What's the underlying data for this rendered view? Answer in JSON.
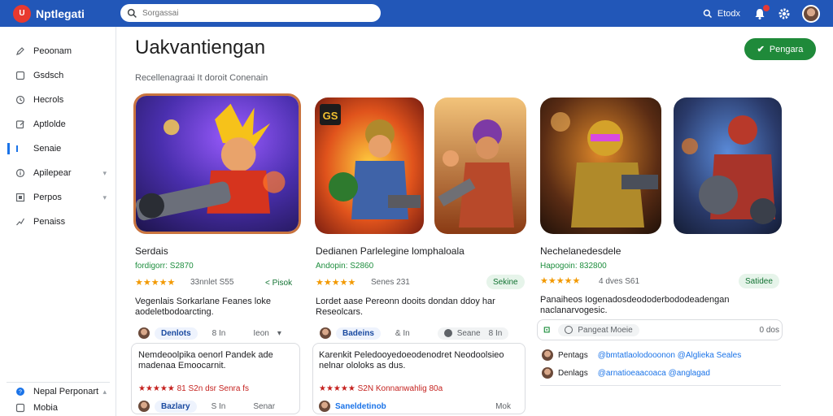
{
  "app": {
    "logo_mark": "U",
    "name": "Nptlegati"
  },
  "search": {
    "placeholder": "Sorgassai"
  },
  "topbar": {
    "search_label": "Etodx"
  },
  "sidebar": {
    "items": [
      {
        "label": "Peoonam",
        "icon": "pencil-icon"
      },
      {
        "label": "Gsdsch",
        "icon": "square-icon"
      },
      {
        "label": "Hecrols",
        "icon": "clock-icon"
      },
      {
        "label": "Aptlolde",
        "icon": "edit-icon"
      },
      {
        "label": "Senaie",
        "icon": "bar-icon",
        "active": true
      },
      {
        "label": "Apilepear",
        "icon": "info-icon"
      },
      {
        "label": "Perpos",
        "icon": "box-icon"
      },
      {
        "label": "Penaiss",
        "icon": "path-icon"
      }
    ],
    "footer": [
      {
        "label": "Nepal Perponart",
        "icon": "help-icon"
      },
      {
        "label": "Mobia",
        "icon": "square-icon"
      }
    ]
  },
  "main": {
    "title": "Uakvantiengan",
    "subtitle": "Recellenagraai It doroit Conenain",
    "install_button": "Pengara"
  },
  "cards": [
    {
      "title": "Serdais",
      "price": "fordigorr: S2870",
      "stars": "★★★★★",
      "reviews": "33nnlet S55",
      "chip": "< Pisok",
      "desc_lines": [
        "Vegenlais Sorkarlane Feanes loke",
        "aodeletbodoarcting."
      ],
      "chips_row": {
        "user": "Denlots",
        "count": "8 In",
        "action": "Ieon"
      },
      "review": {
        "text_lines": [
          "Nemdeoolpika oenorl Pandek ade",
          "madenaa Emoocarnit."
        ],
        "rating": "★★★★★ 81 S2n dsr Senra fs",
        "user": "Bazlary",
        "count": "S In",
        "action": "Senar"
      }
    },
    {
      "title": "Dedianen Parlelegine lomphaloala",
      "price": "Andopin: S2860",
      "stars": "★★★★★",
      "reviews": "Senes 231",
      "chip": "Sekine",
      "desc_lines": [
        "Lordet aase Pereonn dooits dondan ddoy har",
        "Reseolcars."
      ],
      "chips_row": {
        "user": "Badeins",
        "count": "& In",
        "toggle": "Seane",
        "num": "8 In"
      },
      "review": {
        "text_lines": [
          "Karenkit Peledooyedoeodenodret Neodoolsieo",
          "nelnar ololoks as dus."
        ],
        "rating": "★★★★★ S2N Konnanwahlig 80a",
        "user": "Saneldetinob",
        "action": "Mok"
      }
    },
    {
      "title": "Nechelanedesdele",
      "price": "Hapogoin: 832800",
      "stars": "★★★★★",
      "reviews": "4 dves S61",
      "chip": "Satidee",
      "desc_lines": [
        "Panaiheos Iogenadosdeododerbododeadengan",
        "naclanarvogesic."
      ],
      "chips_row": {
        "tag": "Pangeat Moeie",
        "num": "0 dos"
      },
      "mentions": [
        {
          "user": "Pentags",
          "handle": "@bmtatlaolodooonon @Alglieka Seales"
        },
        {
          "user": "Denlags",
          "handle": "@arnatioeaacoaca @anglagad"
        }
      ]
    }
  ]
}
